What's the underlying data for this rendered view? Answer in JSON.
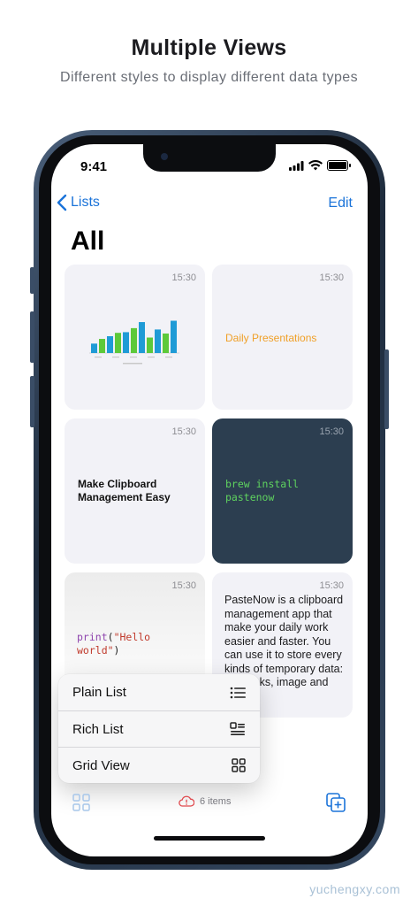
{
  "promo": {
    "title": "Multiple Views",
    "subtitle": "Different styles to display different data types"
  },
  "status_bar": {
    "time": "9:41",
    "icons": [
      "cellular-signal-icon",
      "wifi-icon",
      "battery-icon"
    ],
    "battery_level": 1.0
  },
  "nav": {
    "back_label": "Lists",
    "edit_label": "Edit",
    "title": "All"
  },
  "cards": [
    {
      "time": "15:30",
      "kind": "image-chart",
      "chart_bars": [
        0.28,
        0.42,
        0.5,
        0.6,
        0.62,
        0.74,
        0.92,
        0.46,
        0.7,
        0.58,
        0.96
      ]
    },
    {
      "time": "15:30",
      "kind": "text",
      "text": "Daily Presentations",
      "color": "#F0A028"
    },
    {
      "time": "15:30",
      "kind": "text",
      "text": "Make Clipboard Management Easy"
    },
    {
      "time": "15:30",
      "kind": "code",
      "text": "brew install pastenow",
      "background": "#2C3E50",
      "color": "#5FD35F"
    },
    {
      "time": "15:30",
      "kind": "code",
      "fn": "print",
      "open": "(",
      "string": "\"Hello world\"",
      "close": ")"
    },
    {
      "time": "15:30",
      "kind": "text",
      "text": "PasteNow is a clipboard management app that make your daily work easier and faster. You can use it to store every kinds of temporary data: text, links, image and even"
    }
  ],
  "menu": {
    "items": [
      {
        "label": "Plain List",
        "icon": "list-bullet-icon"
      },
      {
        "label": "Rich List",
        "icon": "rich-list-icon"
      },
      {
        "label": "Grid View",
        "icon": "grid-icon"
      }
    ]
  },
  "toolbar": {
    "left_icon": "grid-icon",
    "items_count_label": "6 items",
    "sync_icon": "cloud-alert-icon",
    "right_icon": "add-copy-icon",
    "accent_color": "#1A73D9"
  },
  "watermark": "yuchengxy.com"
}
